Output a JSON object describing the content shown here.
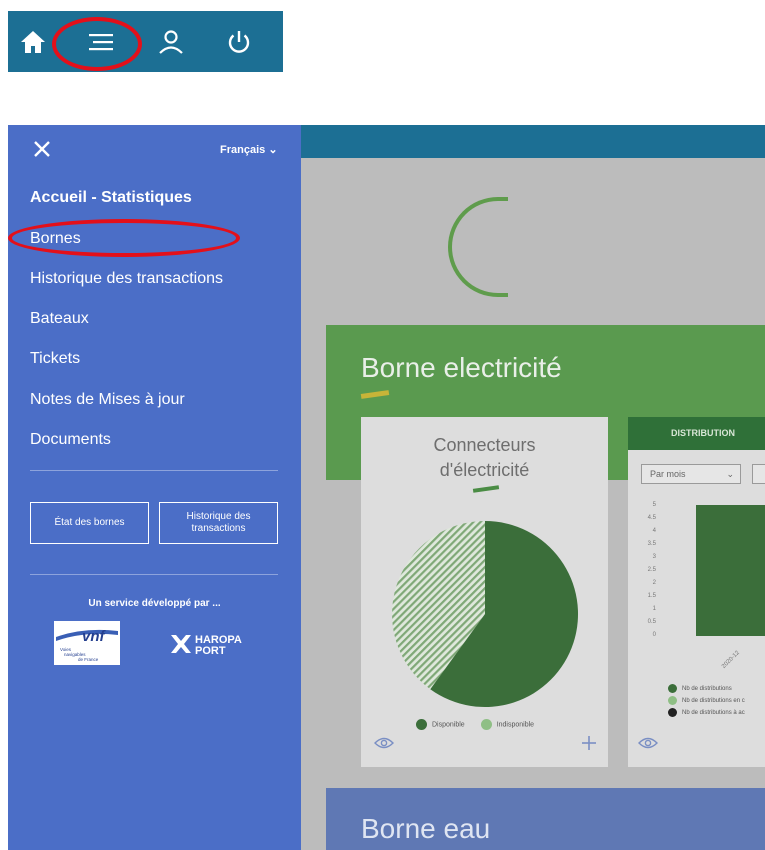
{
  "topbar": {
    "icons": [
      "home-icon",
      "menu-icon",
      "user-icon",
      "power-icon"
    ]
  },
  "sidebar": {
    "language": "Français",
    "items": [
      {
        "label": "Accueil - Statistiques"
      },
      {
        "label": "Bornes"
      },
      {
        "label": "Historique des transactions"
      },
      {
        "label": "Bateaux"
      },
      {
        "label": "Tickets"
      },
      {
        "label": "Notes de Mises à jour"
      },
      {
        "label": "Documents"
      }
    ],
    "buttons": [
      "État des bornes",
      "Historique des transactions"
    ],
    "service_text": "Un service développé par ...",
    "vnf_logo": {
      "name": "vnf",
      "tagline": "Voies navigables de France"
    },
    "haropa_logo": {
      "line1": "HAROPA",
      "line2": "PORT"
    }
  },
  "main": {
    "section_electricity": "Borne electricité",
    "connectors_card": {
      "title_line1": "Connecteurs",
      "title_line2": "d'électricité",
      "legend": [
        "Disponible",
        "Indisponible"
      ]
    },
    "distribution_card": {
      "title": "DISTRIBUTION",
      "period_select": "Par mois",
      "y_ticks": [
        "5",
        "4.5",
        "4",
        "3.5",
        "3",
        "2.5",
        "2",
        "1.5",
        "1",
        "0.5",
        "0"
      ],
      "x_tick": "2020-12",
      "legend": [
        "Nb de distributions",
        "Nb de distributions en c",
        "Nb de distributions à ac"
      ]
    },
    "section_water": "Borne eau"
  },
  "colors": {
    "nav": "#1c6f94",
    "sidebar": "#4b6ec7",
    "annotation": "#e3101a",
    "green_section": "#5a9a4f",
    "pie_available": "#3b6e3a",
    "pie_unavailable": "#9ebf96"
  }
}
